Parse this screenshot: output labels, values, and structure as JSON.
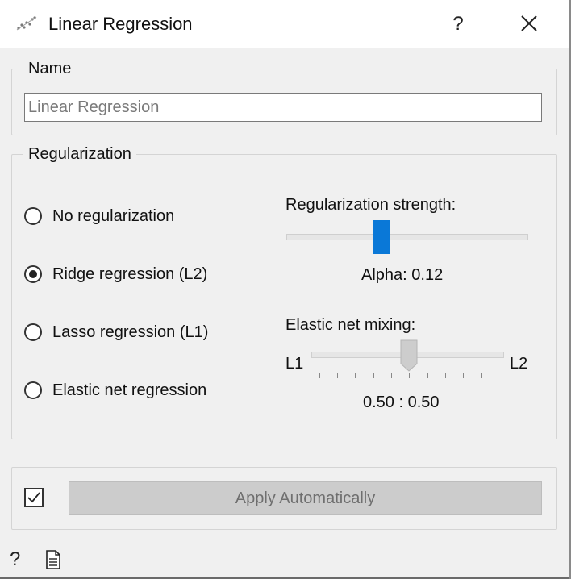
{
  "window": {
    "title": "Linear Regression",
    "help_glyph": "?",
    "icon": "scatter-plot-icon"
  },
  "name_section": {
    "legend": "Name",
    "input_value": "Linear Regression"
  },
  "regularization": {
    "legend": "Regularization",
    "options": [
      {
        "label": "No regularization",
        "checked": false
      },
      {
        "label": "Ridge regression (L2)",
        "checked": true
      },
      {
        "label": "Lasso regression (L1)",
        "checked": false
      },
      {
        "label": "Elastic net regression",
        "checked": false
      }
    ],
    "strength_label": "Regularization strength:",
    "alpha_text": "Alpha: 0.12",
    "strength_position": 0.39,
    "mixing_label": "Elastic net mixing:",
    "mixing_left": "L1",
    "mixing_right": "L2",
    "mixing_text": "0.50 : 0.50",
    "mixing_value": 0.5
  },
  "apply": {
    "checked": true,
    "button_label": "Apply Automatically"
  },
  "colors": {
    "accent": "#0a78d7",
    "disabled_button": "#cccccc",
    "background": "#f0f0f0"
  }
}
